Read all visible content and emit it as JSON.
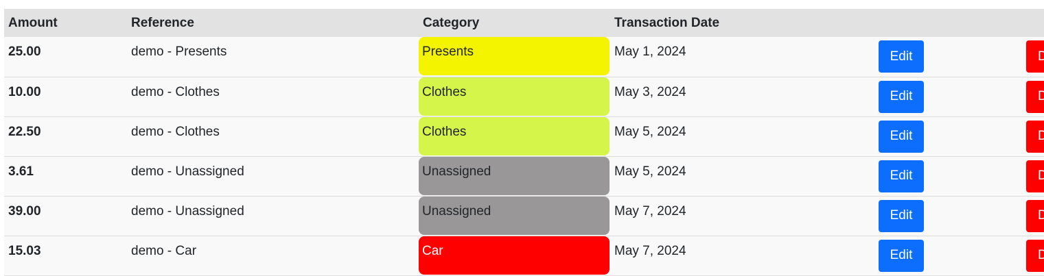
{
  "table": {
    "headers": {
      "amount": "Amount",
      "reference": "Reference",
      "category": "Category",
      "date": "Transaction Date"
    },
    "edit_label": "Edit",
    "delete_label": "Delete",
    "rows": [
      {
        "amount": "25.00",
        "reference": "demo - Presents",
        "category": "Presents",
        "category_color": "#f4f400",
        "category_text_color": "#212529",
        "date": "May 1, 2024"
      },
      {
        "amount": "10.00",
        "reference": "demo - Clothes",
        "category": "Clothes",
        "category_color": "#d6f54a",
        "category_text_color": "#212529",
        "date": "May 3, 2024"
      },
      {
        "amount": "22.50",
        "reference": "demo - Clothes",
        "category": "Clothes",
        "category_color": "#d6f54a",
        "category_text_color": "#212529",
        "date": "May 5, 2024"
      },
      {
        "amount": "3.61",
        "reference": "demo - Unassigned",
        "category": "Unassigned",
        "category_color": "#999797",
        "category_text_color": "#212529",
        "date": "May 5, 2024"
      },
      {
        "amount": "39.00",
        "reference": "demo - Unassigned",
        "category": "Unassigned",
        "category_color": "#999797",
        "category_text_color": "#212529",
        "date": "May 7, 2024"
      },
      {
        "amount": "15.03",
        "reference": "demo - Car",
        "category": "Car",
        "category_color": "#ff0000",
        "category_text_color": "#ffffff",
        "date": "May 7, 2024"
      }
    ]
  },
  "colors": {
    "header_bg": "#e2e2e2",
    "row_bg": "#f9f9f9",
    "edit_button": "#0d6efd",
    "delete_button": "#ff0000"
  }
}
